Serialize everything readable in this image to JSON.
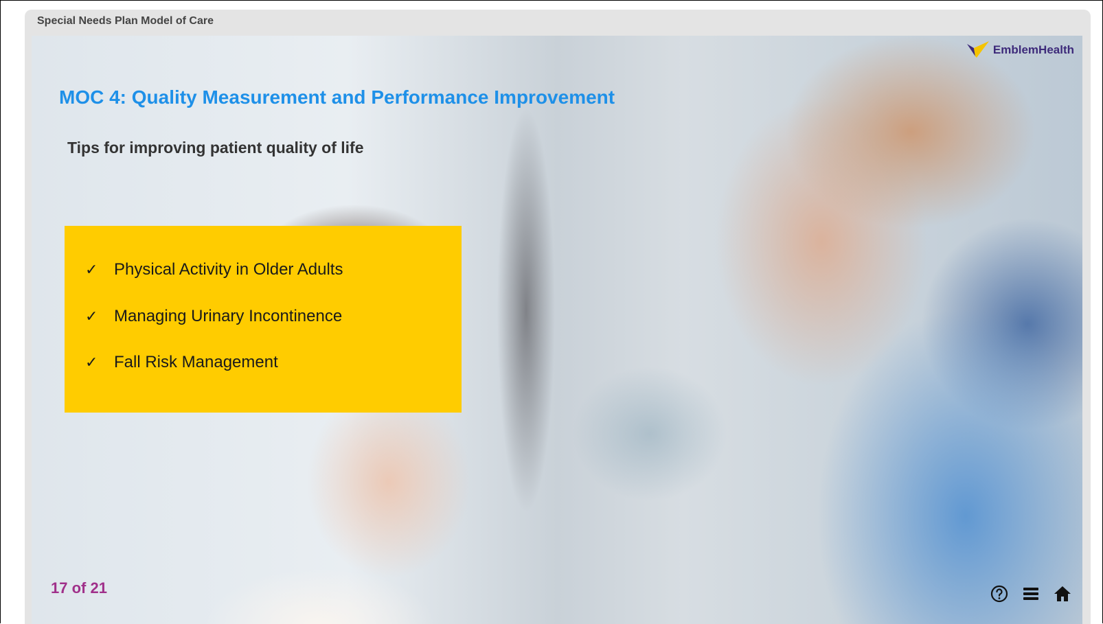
{
  "course": {
    "title": "Special Needs Plan Model of Care"
  },
  "brand": {
    "name": "EmblemHealth",
    "colors": {
      "purple": "#3d2a7a",
      "yellow": "#f5c400",
      "title_blue": "#1e90e8",
      "page_magenta": "#a0308a",
      "box_yellow": "#ffcc00"
    }
  },
  "slide": {
    "title": "MOC 4: Quality Measurement and Performance Improvement",
    "subtitle": "Tips for improving patient quality of life",
    "tips": [
      {
        "check": "✓",
        "label": "Physical Activity in Older Adults"
      },
      {
        "check": "✓",
        "label": "Managing Urinary Incontinence"
      },
      {
        "check": "✓",
        "label": "Fall Risk Management"
      }
    ]
  },
  "footer": {
    "page_indicator": "17 of 21",
    "controls": [
      {
        "icon": "help-circle-icon"
      },
      {
        "icon": "menu-icon"
      },
      {
        "icon": "home-icon"
      }
    ]
  }
}
